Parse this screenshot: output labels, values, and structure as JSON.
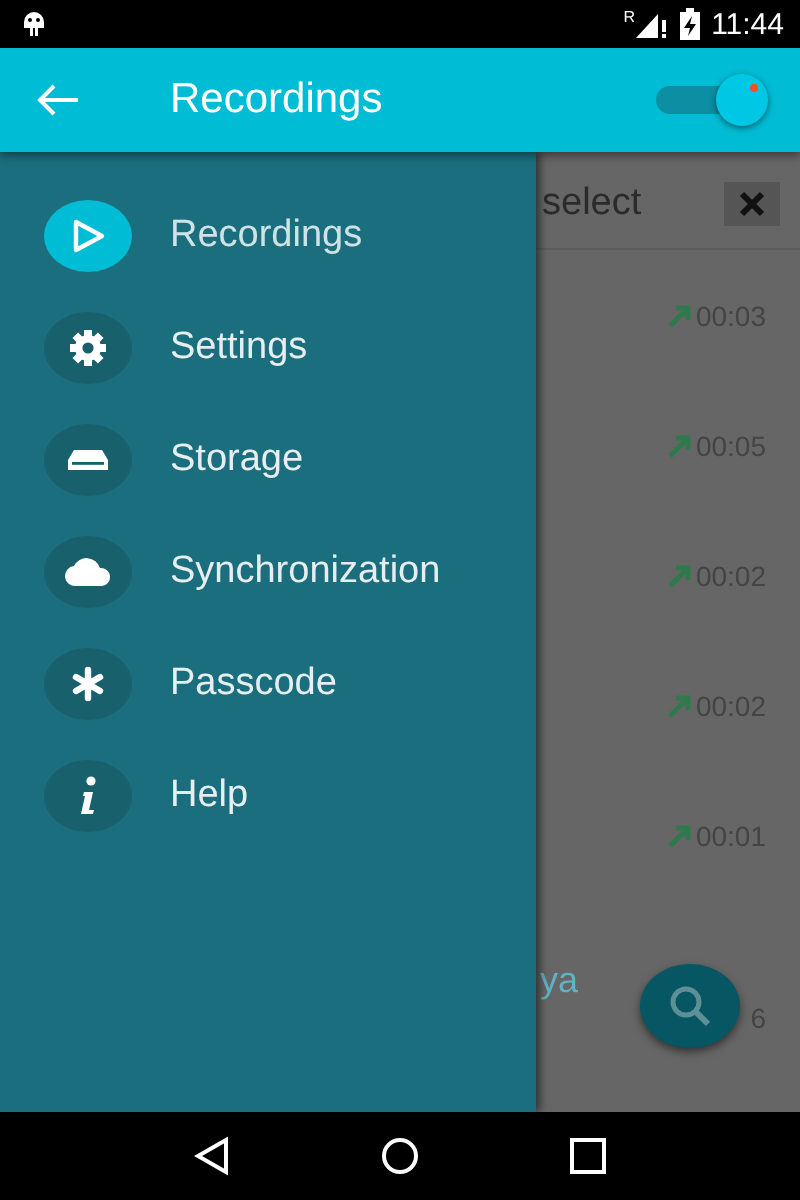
{
  "status_bar": {
    "time": "11:44",
    "roaming": "R"
  },
  "app_bar": {
    "title": "Recordings",
    "toggle": {
      "on": true
    }
  },
  "drawer": {
    "items": [
      {
        "label": "Recordings",
        "selected": true
      },
      {
        "label": "Settings",
        "selected": false
      },
      {
        "label": "Storage",
        "selected": false
      },
      {
        "label": "Synchronization",
        "selected": false
      },
      {
        "label": "Passcode",
        "selected": false
      },
      {
        "label": "Help",
        "selected": false
      }
    ]
  },
  "content": {
    "header": {
      "label": "select"
    },
    "rows": [
      {
        "duration": "00:03"
      },
      {
        "duration": "00:05"
      },
      {
        "duration": "00:02"
      },
      {
        "duration": "00:02"
      },
      {
        "duration": "00:01"
      }
    ],
    "partial_name": "ya",
    "partial_duration": "6"
  }
}
